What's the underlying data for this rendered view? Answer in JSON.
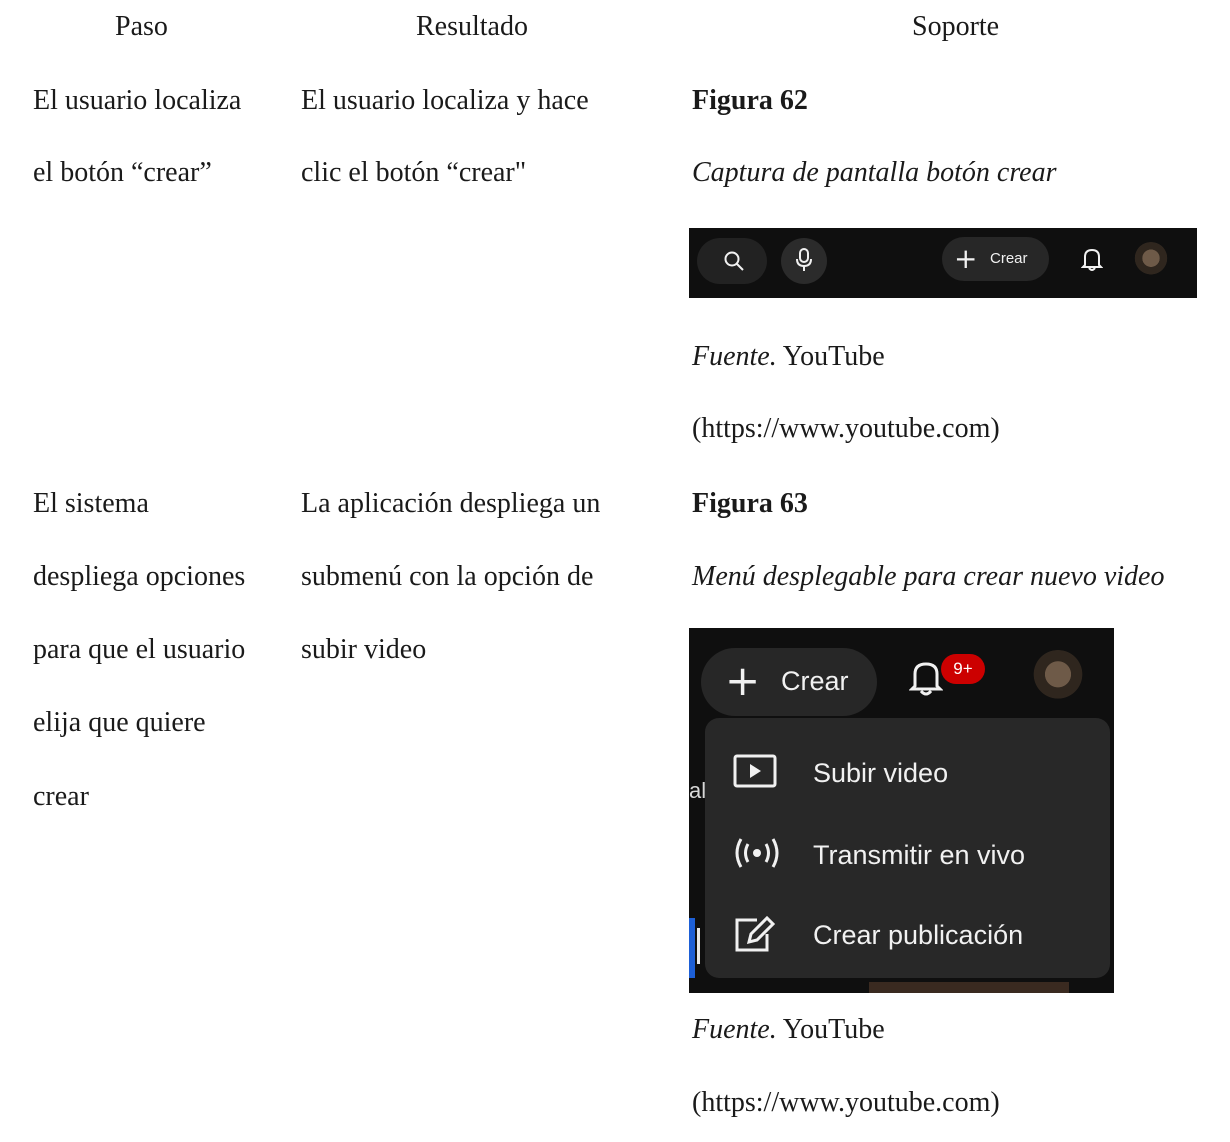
{
  "headers": {
    "paso": "Paso",
    "resultado": "Resultado",
    "soporte": "Soporte"
  },
  "row1": {
    "paso": [
      "El usuario localiza",
      "el botón “crear”"
    ],
    "resultado": [
      "El usuario localiza y hace",
      "clic el botón “crear\""
    ],
    "figura": "Figura 62",
    "caption": "Captura de pantalla botón crear",
    "screenshot": {
      "crear_label": "Crear",
      "icons": [
        "search-icon",
        "mic-icon",
        "plus-icon",
        "bell-icon",
        "avatar"
      ]
    },
    "fuente_label": "Fuente.",
    "fuente_source": "YouTube",
    "fuente_url": "(https://www.youtube.com)"
  },
  "row2": {
    "paso": [
      "El sistema",
      "despliega opciones",
      "para que el usuario",
      "elija que quiere",
      "crear"
    ],
    "resultado": [
      "La aplicación despliega un",
      "submenú con la opción de",
      "subir video"
    ],
    "figura": "Figura 63",
    "caption": "Menú desplegable para crear nuevo video",
    "screenshot": {
      "crear_label": "Crear",
      "badge": "9+",
      "edge_text": "al",
      "menu": [
        {
          "label": "Subir video",
          "icon": "upload-video-icon"
        },
        {
          "label": "Transmitir en vivo",
          "icon": "live-broadcast-icon"
        },
        {
          "label": "Crear publicación",
          "icon": "edit-post-icon"
        }
      ],
      "colors": {
        "background": "#0f0f0f",
        "menu": "#282828",
        "badge": "#cc0000"
      }
    },
    "fuente_label": "Fuente.",
    "fuente_source": "YouTube",
    "fuente_url": "(https://www.youtube.com)"
  }
}
